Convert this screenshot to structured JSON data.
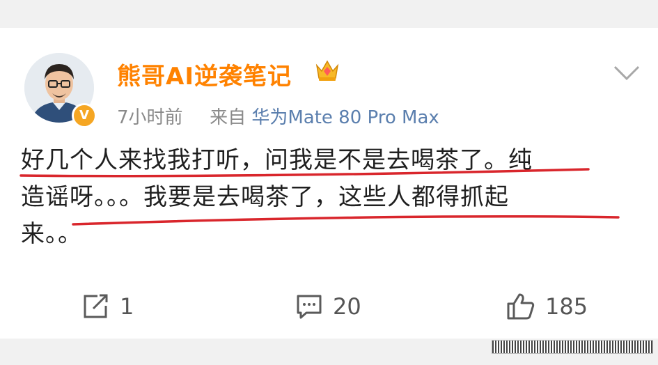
{
  "post": {
    "username": "熊哥AI逆袭笔记",
    "time": "7小时前",
    "source_prefix": "来自",
    "device": "华为Mate 80 Pro Max",
    "text_line1": "好几个人来找我打听，问我是不是去喝茶了。纯",
    "text_line2": "造谣呀。。。我要是去喝茶了，这些人都得抓起",
    "text_line3": "来。。"
  },
  "actions": {
    "repost_count": "1",
    "comment_count": "20",
    "like_count": "185"
  },
  "icons": {
    "avatar": "avatar-portrait",
    "verified": "verified-badge-icon",
    "crown": "crown-icon",
    "more": "chevron-down-icon",
    "repost": "repost-icon",
    "comment": "comment-icon",
    "like": "thumbs-up-icon"
  },
  "colors": {
    "username": "#ff8200",
    "device": "#5b7fae",
    "underline": "#d9262c",
    "verified": "#f5a623"
  }
}
